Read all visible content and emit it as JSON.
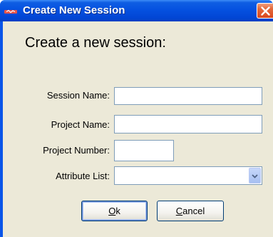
{
  "window": {
    "title": "Create New Session"
  },
  "form": {
    "heading": "Create a new session:",
    "fields": [
      {
        "label": "Session Name:",
        "value": "",
        "placeholder": ""
      },
      {
        "label": "Project Name:",
        "value": "",
        "placeholder": ""
      },
      {
        "label": "Project Number:",
        "value": "",
        "placeholder": ""
      },
      {
        "label": "Attribute List:",
        "value": ""
      }
    ]
  },
  "buttons": {
    "ok": {
      "mnemonic": "O",
      "rest": "k"
    },
    "cancel": {
      "mnemonic": "C",
      "rest": "ancel"
    }
  },
  "icons": {
    "app": "app-icon",
    "close": "close-icon",
    "dropdown": "chevron-down-icon"
  },
  "colors": {
    "titlebar": "#0551e0",
    "close": "#d9481e",
    "dialog_bg": "#ece9d8",
    "field_border": "#7f9db9"
  }
}
